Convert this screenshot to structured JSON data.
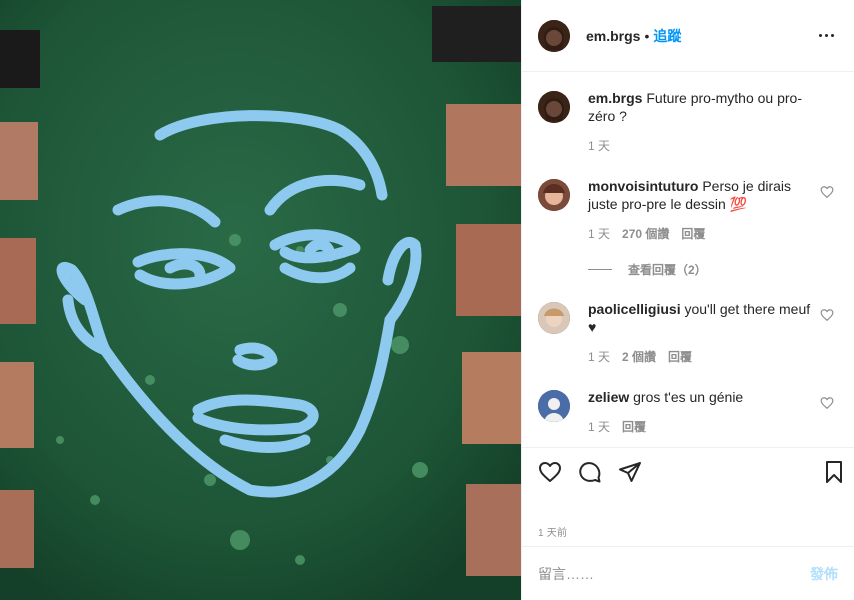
{
  "post": {
    "username": "em.brgs",
    "dot": "•",
    "follow_label": "追蹤"
  },
  "comments": [
    {
      "username": "em.brgs",
      "text": "Future pro-mytho ou pro-zéro ?",
      "time": "1 天"
    },
    {
      "username": "monvoisintuturo",
      "text": "Perso je dirais juste pro-pre le dessin 💯",
      "time": "1 天",
      "likes": "270 個讚",
      "reply_label": "回覆",
      "view_replies": "查看回覆（2）"
    },
    {
      "username": "paolicelligiusi",
      "text": "you'll get there meuf ♥",
      "time": "1 天",
      "likes": "2 個讚",
      "reply_label": "回覆"
    },
    {
      "username": "zeliew",
      "text": "gros t'es un génie",
      "time": "1 天",
      "reply_label": "回覆"
    }
  ],
  "actions": {
    "like_icon": "heart-icon",
    "comment_icon": "comment-icon",
    "share_icon": "paper-plane-icon",
    "save_icon": "bookmark-icon"
  },
  "timestamp": "1 天前",
  "add_comment": {
    "placeholder": "留言……",
    "post_label": "發佈"
  },
  "colors": {
    "accent": "#0095f6",
    "post_disabled": "#b2dffc",
    "bench_green": "#1f5a3c",
    "chalk_blue": "#8ec9ef"
  }
}
